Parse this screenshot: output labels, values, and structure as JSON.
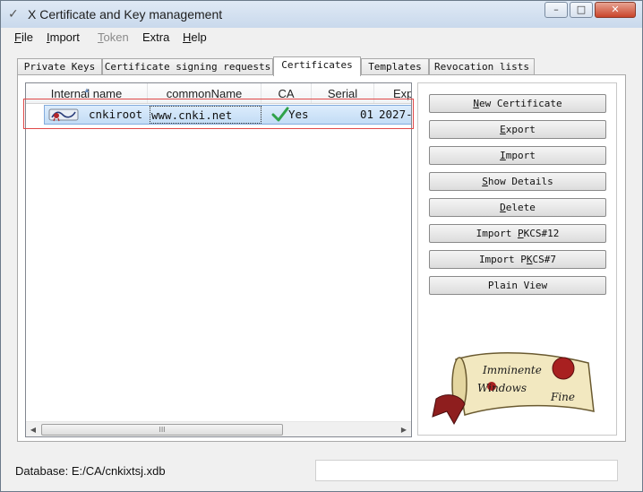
{
  "window": {
    "title": "X Certificate and Key management",
    "minimize_glyph": "–",
    "maximize_glyph": "□",
    "close_glyph": "✕"
  },
  "menu": {
    "file_accel": "F",
    "file_rest": "ile",
    "import_accel": "I",
    "import_rest": "mport",
    "token_accel": "T",
    "token_rest": "oken",
    "extra_label": "Extra",
    "help_accel": "H",
    "help_rest": "elp"
  },
  "tabs": {
    "private_keys": "Private Keys",
    "csr": "Certificate signing requests",
    "certificates": "Certificates",
    "templates": "Templates",
    "revocation": "Revocation lists"
  },
  "table": {
    "headers": {
      "internal_name": "Internal name",
      "common_name": "commonName",
      "ca": "CA",
      "serial": "Serial",
      "expiry": "Exp"
    },
    "rows": [
      {
        "internal_name": "cnkiroot",
        "common_name": "www.cnki.net",
        "ca": "Yes",
        "serial": "01",
        "expiry": "2027-"
      }
    ],
    "scroll_grip": "III"
  },
  "actions": {
    "new_accel": "N",
    "new_rest": "ew Certificate",
    "export_accel": "E",
    "export_rest": "xport",
    "import_accel": "I",
    "import_rest": "mport",
    "show_accel": "S",
    "show_rest": "how Details",
    "delete_accel": "D",
    "delete_rest": "elete",
    "pkcs12_pre": "Import ",
    "pkcs12_accel": "P",
    "pkcs12_rest": "KCS#12",
    "pkcs7_pre": "Import P",
    "pkcs7_accel": "K",
    "pkcs7_rest": "CS#7",
    "plain_view": "Plain View"
  },
  "logo": {
    "line1": "Imminente",
    "line2": "Windows",
    "line3": "Fine",
    "seal_color": "#a82020",
    "paper_color": "#f2e8c0"
  },
  "status": {
    "database_path": "Database: E:/CA/cnkixtsj.xdb"
  },
  "colors": {
    "selection_outline": "#e04848",
    "check_green": "#2fa24a"
  },
  "icons": [
    "app-icon",
    "certificate-icon",
    "check-icon",
    "sort-arrow-icon",
    "scroll-left-icon",
    "scroll-right-icon",
    "scroll-logo"
  ]
}
